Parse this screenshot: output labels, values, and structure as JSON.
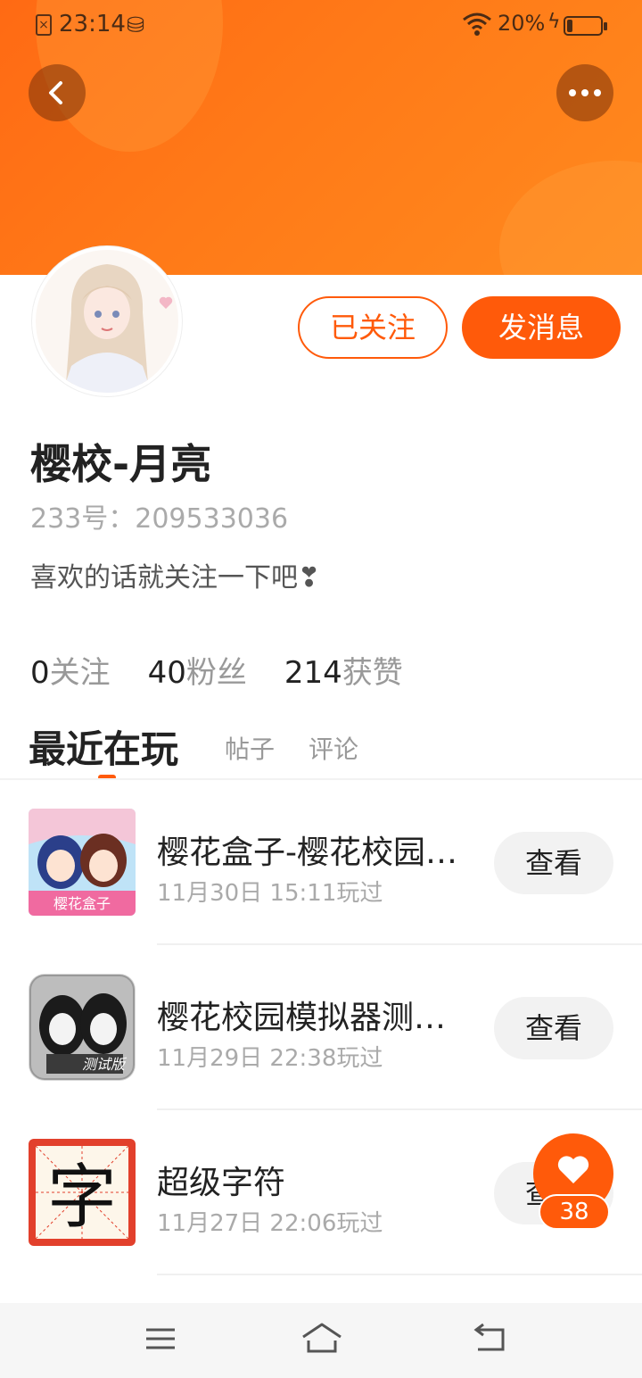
{
  "status_bar": {
    "time": "23:14",
    "battery_percent": "20%",
    "battery_level": 0.2,
    "icons": [
      "sim-error-icon",
      "data-warning-icon",
      "wifi-icon",
      "charging-icon",
      "battery-icon"
    ]
  },
  "header": {
    "back_icon": "back-arrow-icon",
    "more_icon": "more-dots-icon"
  },
  "profile": {
    "name": "樱校-月亮",
    "id_text": "233号：209533036",
    "bio": "喜欢的话就关注一下吧❣",
    "followed_label": "已关注",
    "message_label": "发消息"
  },
  "stats": [
    {
      "num": "0",
      "label": "关注"
    },
    {
      "num": "40",
      "label": "粉丝"
    },
    {
      "num": "214",
      "label": "获赞"
    }
  ],
  "tabs": {
    "active": "最近在玩",
    "posts": "帖子",
    "comments": "评论"
  },
  "games": [
    {
      "title": "樱花盒子-樱花校园模拟器",
      "time": "11月30日 15:11玩过",
      "view": "查看",
      "icon_caption": "樱花盒子"
    },
    {
      "title": "樱花校园模拟器测试版",
      "time": "11月29日 22:38玩过",
      "view": "查看",
      "icon_caption": "测试版"
    },
    {
      "title": "超级字符",
      "time": "11月27日 22:06玩过",
      "view": "查看",
      "icon_caption": "字"
    }
  ],
  "like": {
    "count": "38",
    "icon": "heart-icon"
  },
  "nav": {
    "menu_icon": "menu-icon",
    "home_icon": "home-icon",
    "back_icon": "return-icon"
  },
  "colors": {
    "accent": "#ff5a0a",
    "banner": "#ff7a18"
  }
}
